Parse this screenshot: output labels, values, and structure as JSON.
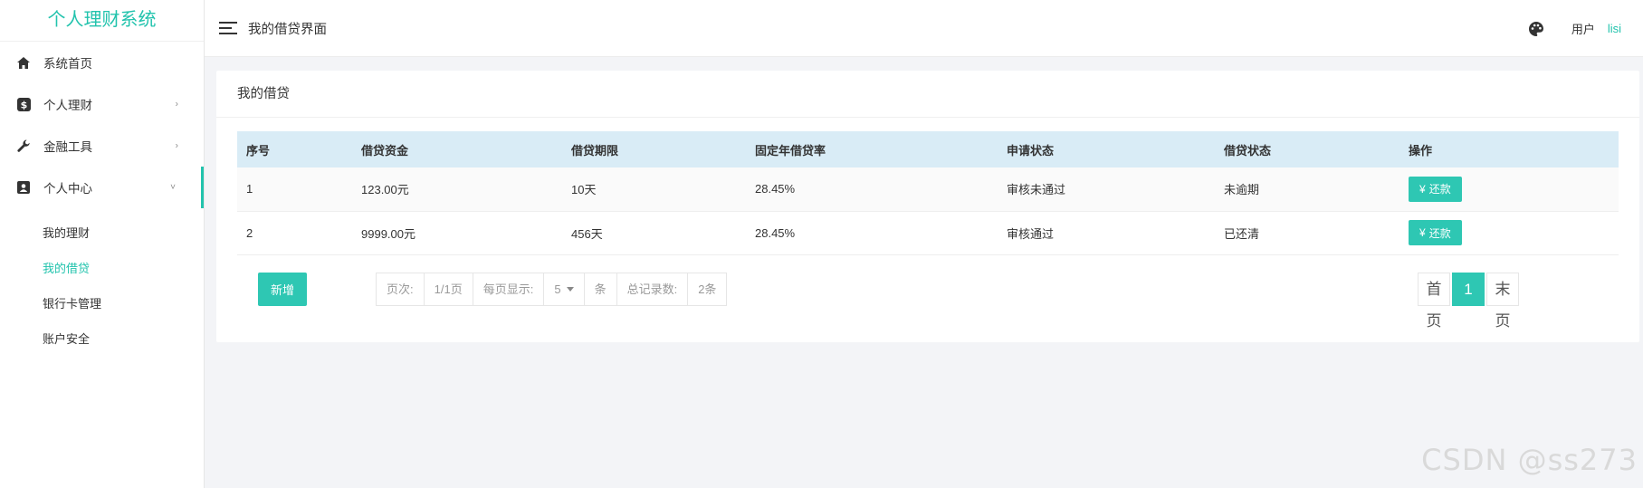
{
  "app": {
    "title": "个人理财系统"
  },
  "sidebar": {
    "items": [
      {
        "label": "系统首页",
        "icon": "home-icon"
      },
      {
        "label": "个人理财",
        "icon": "dollar-icon",
        "arrow": "›"
      },
      {
        "label": "金融工具",
        "icon": "wrench-icon",
        "arrow": "›"
      },
      {
        "label": "个人中心",
        "icon": "id-card-icon",
        "arrow": "˅"
      }
    ],
    "submenu": [
      {
        "label": "我的理财"
      },
      {
        "label": "我的借贷"
      },
      {
        "label": "银行卡管理"
      },
      {
        "label": "账户安全"
      }
    ]
  },
  "header": {
    "title": "我的借贷界面",
    "user_label": "用户",
    "user_name": "lisi"
  },
  "card": {
    "title": "我的借贷",
    "columns": [
      "序号",
      "借贷资金",
      "借贷期限",
      "固定年借贷率",
      "申请状态",
      "借贷状态",
      "操作"
    ],
    "rows": [
      {
        "id": "1",
        "amount": "123.00元",
        "term": "10天",
        "rate": "28.45%",
        "apply_status": "审核未通过",
        "loan_status": "未逾期",
        "action": "还款"
      },
      {
        "id": "2",
        "amount": "9999.00元",
        "term": "456天",
        "rate": "28.45%",
        "apply_status": "审核通过",
        "loan_status": "已还清",
        "action": "还款"
      }
    ],
    "add_label": "新增",
    "pager_info": {
      "page_label": "页次:",
      "page_value": "1/1页",
      "size_label": "每页显示:",
      "size_value": "5",
      "size_unit": "条",
      "total_label": "总记录数:",
      "total_value": "2条"
    },
    "pager": {
      "first": "首页",
      "current": "1",
      "last": "末页"
    }
  },
  "watermark": "CSDN @ss273",
  "colors": {
    "accent": "#2ec7b3",
    "brand": "#22c3ad",
    "table_header": "#d9ecf6"
  }
}
